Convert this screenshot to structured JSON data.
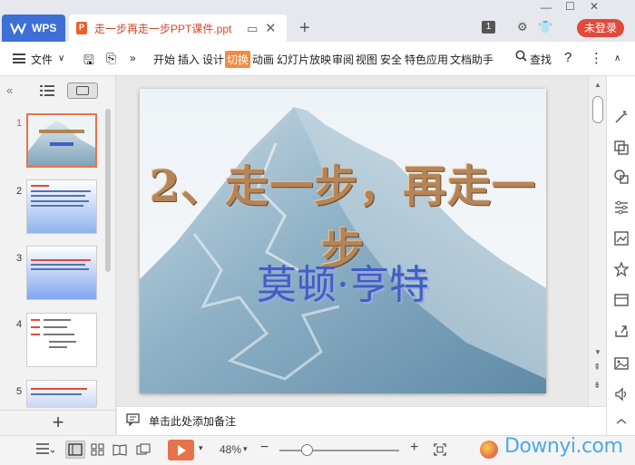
{
  "titlebar": {
    "app_tab": "WPS",
    "doc_tab_title": "走一步再走一步PPT课件.ppt",
    "login_label": "未登录",
    "badge": "1"
  },
  "menu": {
    "file_label": "文件",
    "more": "»",
    "items": [
      "开始",
      "插入",
      "设计",
      "切换",
      "动画",
      "幻灯片放映",
      "审阅",
      "视图",
      "安全",
      "特色应用",
      "文档助手"
    ],
    "active_item": "切换",
    "search_label": "查找",
    "help": "?",
    "more_menu": "⋮"
  },
  "slides_panel": {
    "collapse": "«",
    "add": "+",
    "thumbnails": [
      {
        "num": "1",
        "selected": true
      },
      {
        "num": "2",
        "selected": false
      },
      {
        "num": "3",
        "selected": false
      },
      {
        "num": "4",
        "selected": false
      },
      {
        "num": "5",
        "selected": false
      }
    ]
  },
  "slide": {
    "title": "2、走一步，再走一步",
    "subtitle": "莫顿·亨特"
  },
  "notes": {
    "placeholder": "单击此处添加备注"
  },
  "statusbar": {
    "zoom": "48%",
    "minus": "−",
    "plus": "+",
    "watermark": "Downyi.com"
  },
  "colors": {
    "accent": "#e8734a",
    "wps_blue": "#3e6fd6",
    "login_red": "#e04a3a",
    "title_brown": "#b58458",
    "subtitle_blue": "#3f5fc5"
  }
}
